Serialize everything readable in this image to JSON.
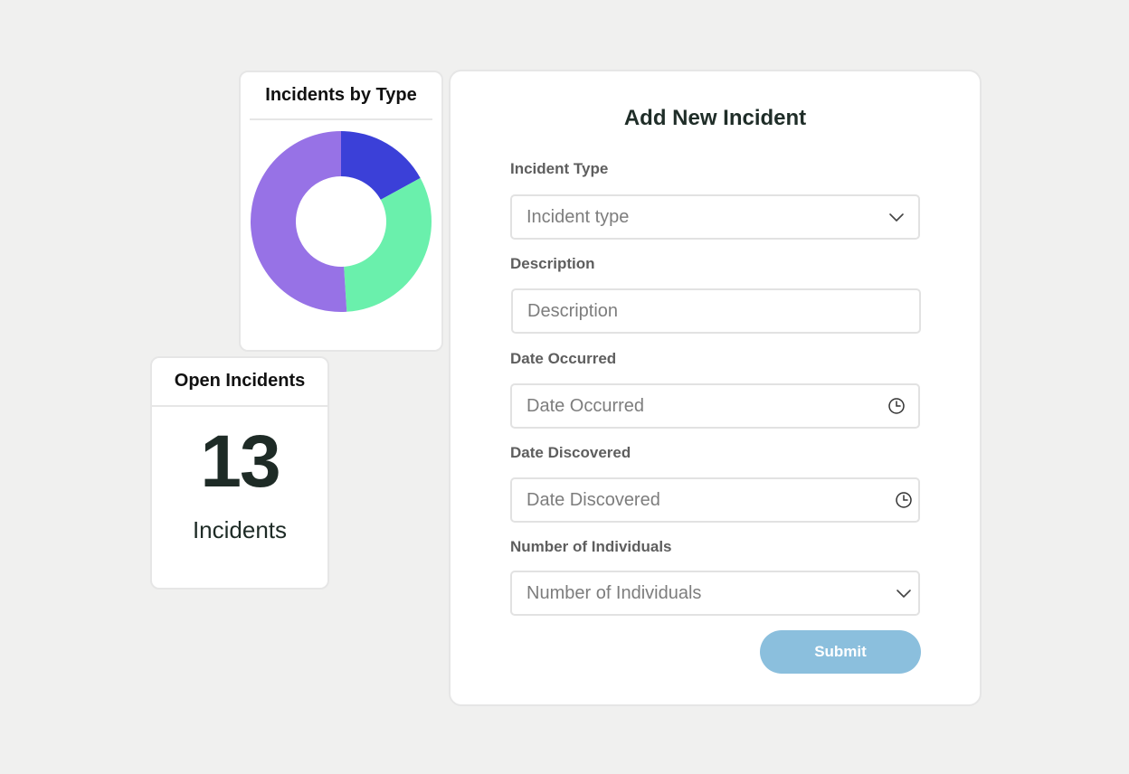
{
  "chart_card": {
    "title": "Incidents by Type"
  },
  "chart_data": {
    "type": "pie",
    "donut": true,
    "title": "Incidents by Type",
    "values": [
      17,
      32,
      51
    ],
    "colors": [
      "#3b40d8",
      "#6af0ac",
      "#9772e6"
    ]
  },
  "open_card": {
    "title": "Open Incidents",
    "count": "13",
    "unit": "Incidents"
  },
  "form": {
    "title": "Add New Incident",
    "incident_type": {
      "label": "Incident Type",
      "placeholder": "Incident type",
      "icon": "chevron-down-icon"
    },
    "description": {
      "label": "Description",
      "placeholder": "Description"
    },
    "date_occurred": {
      "label": "Date Occurred",
      "placeholder": "Date Occurred",
      "icon": "clock-icon"
    },
    "date_discovered": {
      "label": "Date Discovered",
      "placeholder": "Date Discovered",
      "icon": "clock-icon"
    },
    "num_individuals": {
      "label": "Number of Individuals",
      "placeholder": "Number of Individuals",
      "icon": "chevron-down-icon"
    },
    "submit_label": "Submit",
    "submit_color": "#8bbfdd"
  }
}
